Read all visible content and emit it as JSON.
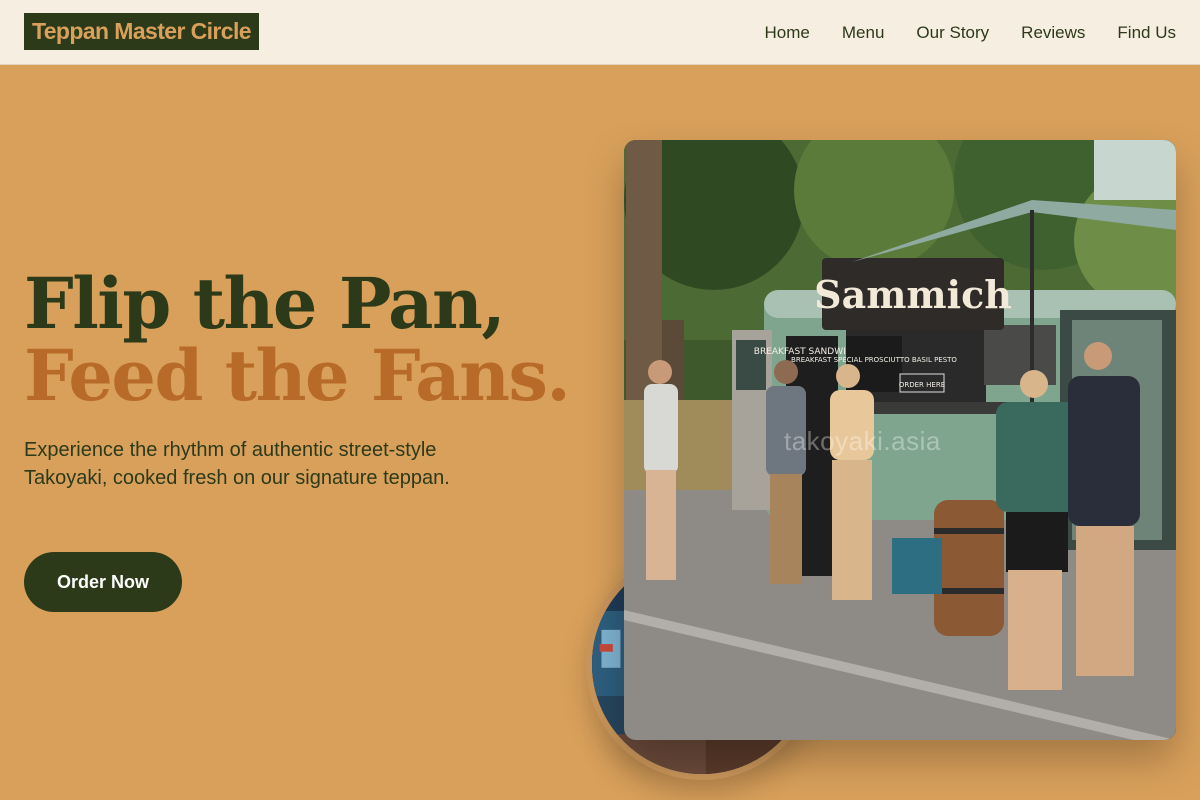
{
  "header": {
    "brand": "Teppan Master Circle",
    "nav": [
      {
        "label": "Home"
      },
      {
        "label": "Menu"
      },
      {
        "label": "Our Story"
      },
      {
        "label": "Reviews"
      },
      {
        "label": "Find Us"
      }
    ]
  },
  "hero": {
    "headline_line1": "Flip the Pan,",
    "headline_line2": "Feed the Fans.",
    "subtext": "Experience the rhythm of authentic street-style Takoyaki, cooked fresh on our signature teppan.",
    "cta_label": "Order Now"
  },
  "photo": {
    "sign_text": "Sammich",
    "menu_board_1": "BREAKFAST SANDWICHES",
    "menu_board_2": "BREAKFAST SPECIAL PROSCIUTTO BASIL PESTO",
    "order_sign": "ORDER HERE",
    "watermark": "takoyaki.asia"
  },
  "colors": {
    "background": "#D9A05B",
    "header_bg": "#F7EEE2",
    "dark_green": "#2C3A1A",
    "accent_orange": "#B86A28"
  }
}
